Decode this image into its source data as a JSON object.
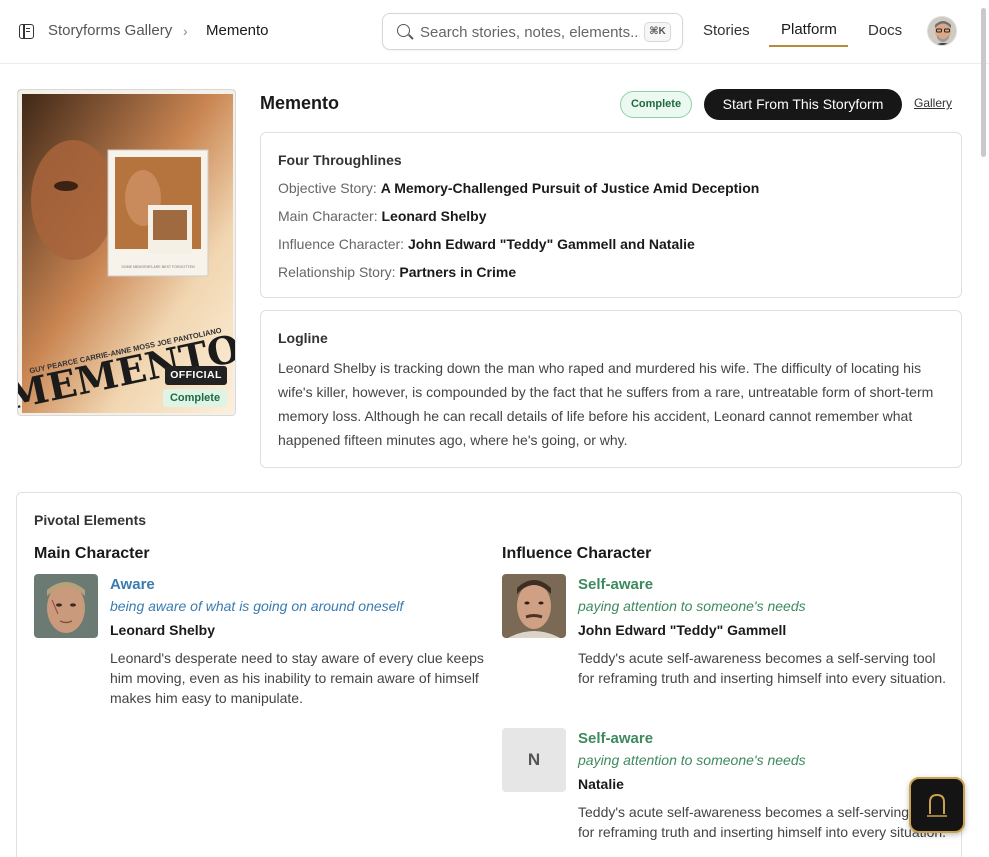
{
  "header": {
    "breadcrumb_parent": "Storyforms Gallery",
    "breadcrumb_separator": "›",
    "breadcrumb_current": "Memento",
    "search_placeholder": "Search stories, notes, elements...",
    "search_shortcut": "⌘K",
    "nav": {
      "stories": "Stories",
      "platform": "Platform",
      "docs": "Docs"
    },
    "active_nav": "Platform"
  },
  "poster": {
    "badge_official": "OFFICIAL",
    "badge_status": "Complete",
    "text_top": "SOME MEMORIES ARE BEST FORGOTTEN",
    "cast": "GUY PEARCE  CARRIE-ANNE MOSS  JOE PANTOLIANO",
    "title_art": "MEMENTO"
  },
  "storyform": {
    "title": "Memento",
    "status": "Complete",
    "start_button": "Start From This Storyform",
    "gallery_link": "Gallery"
  },
  "throughlines": {
    "heading": "Four Throughlines",
    "items": [
      {
        "label": "Objective Story:",
        "value": "A Memory-Challenged Pursuit of Justice Amid Deception"
      },
      {
        "label": "Main Character:",
        "value": "Leonard Shelby"
      },
      {
        "label": "Influence Character:",
        "value": "John Edward \"Teddy\" Gammell and Natalie"
      },
      {
        "label": "Relationship Story:",
        "value": "Partners in Crime"
      }
    ]
  },
  "logline": {
    "heading": "Logline",
    "text": "Leonard Shelby is tracking down the man who raped and murdered his wife. The difficulty of locating his wife's killer, however, is compounded by the fact that he suffers from a rare, untreatable form of short-term memory loss. Although he can recall details of life before his accident, Leonard cannot remember what happened fifteen minutes ago, where he's going, or why."
  },
  "pivotal": {
    "heading": "Pivotal Elements",
    "main_character": {
      "heading": "Main Character",
      "entries": [
        {
          "element": "Aware",
          "definition": "being aware of what is going on around oneself",
          "character": "Leonard Shelby",
          "description": "Leonard's desperate need to stay aware of every clue keeps him moving, even as his inability to remain aware of himself makes him easy to manipulate."
        }
      ]
    },
    "influence_character": {
      "heading": "Influence Character",
      "entries": [
        {
          "element": "Self-aware",
          "definition": "paying attention to someone's needs",
          "character": "John Edward \"Teddy\" Gammell",
          "description": "Teddy's acute self-awareness becomes a self-serving tool for reframing truth and inserting himself into every situation."
        },
        {
          "element": "Self-aware",
          "definition": "paying attention to someone's needs",
          "character": "Natalie",
          "initial": "N",
          "description": "Teddy's acute self-awareness becomes a self-serving tool for reframing truth and inserting himself into every situation."
        }
      ]
    }
  },
  "colors": {
    "accent_gold": "#b58c3a",
    "mc_element": "#3a7bb0",
    "ic_element": "#3e8a5e",
    "complete_green": "#1e6a3f"
  }
}
